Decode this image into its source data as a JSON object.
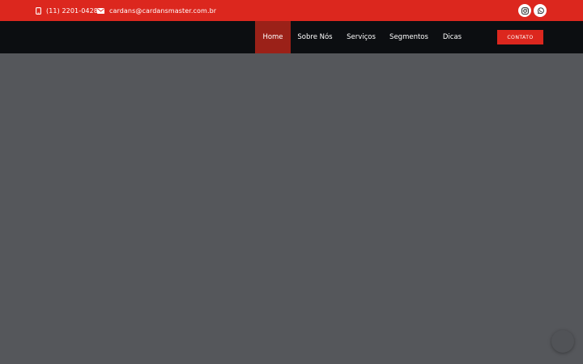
{
  "topbar": {
    "phone": {
      "icon": "phone-icon",
      "text": "(11) 2201-0428"
    },
    "email": {
      "icon": "envelope-icon",
      "text": "cardans@cardansmaster.com.br"
    },
    "social": [
      {
        "name": "instagram",
        "icon": "instagram-icon"
      },
      {
        "name": "whatsapp",
        "icon": "whatsapp-icon"
      }
    ],
    "background": "#dc271e"
  },
  "nav": {
    "items": [
      {
        "label": "Home",
        "active": true
      },
      {
        "label": "Sobre Nós",
        "active": false
      },
      {
        "label": "Serviços",
        "active": false
      },
      {
        "label": "Segmentos",
        "active": false
      },
      {
        "label": "Dicas",
        "active": false
      }
    ],
    "cta_label": "CONTATO",
    "background": "#0c0e11",
    "active_background": "#9b2118"
  },
  "hero": {
    "background": "#55575b"
  }
}
